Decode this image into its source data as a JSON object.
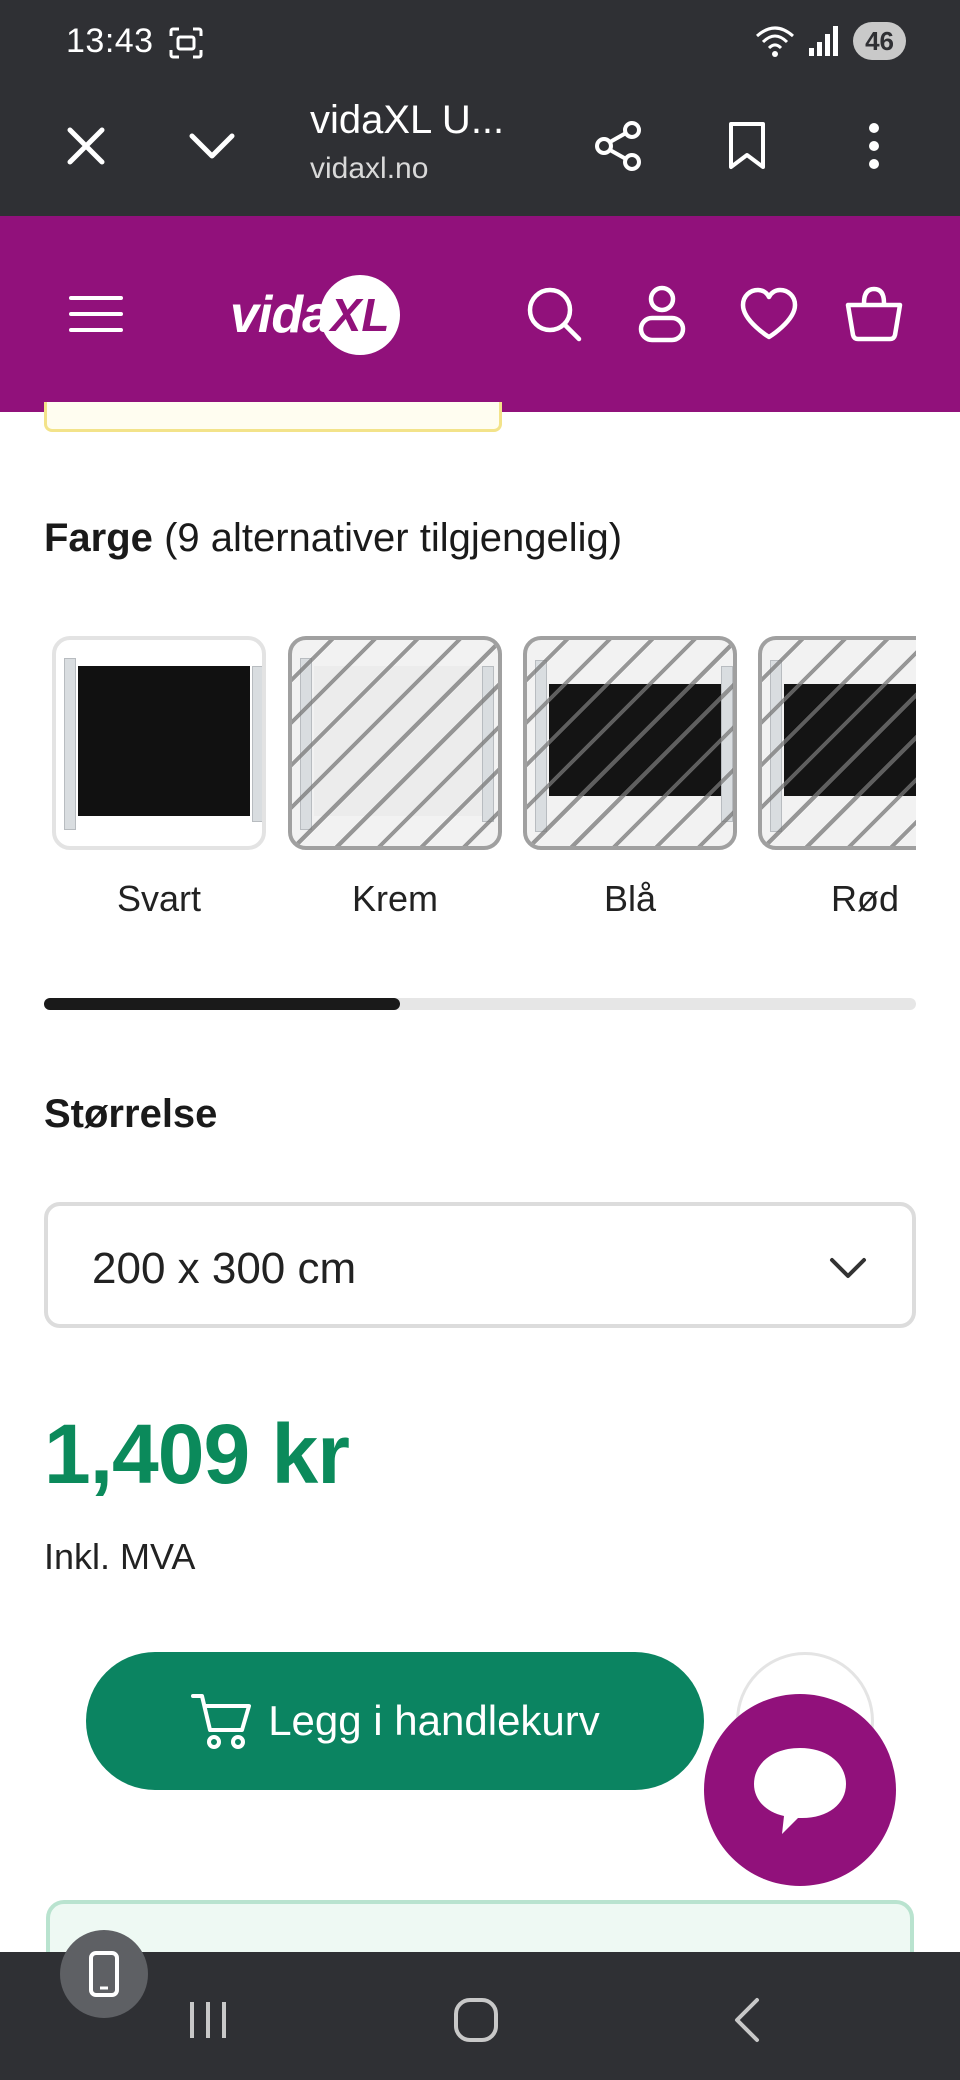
{
  "status_bar": {
    "time": "13:43",
    "battery": "46"
  },
  "browser": {
    "title": "vidaXL U...",
    "url": "vidaxl.no"
  },
  "site": {
    "logo_text": "vida",
    "logo_mark": "XL",
    "brand_color": "#91117b"
  },
  "product": {
    "color_heading": "Farge",
    "color_count": "(9 alternativer tilgjengelig)",
    "colors": [
      {
        "label": "Svart",
        "available": true,
        "selected": true
      },
      {
        "label": "Krem",
        "available": false
      },
      {
        "label": "Blå",
        "available": false
      },
      {
        "label": "Rød",
        "available": false
      }
    ],
    "size_heading": "Størrelse",
    "size_value": "200 x 300 cm",
    "price": "1,409 kr",
    "price_color": "#0b8a5b",
    "vat_note": "Inkl. MVA",
    "add_to_cart": "Legg i handlekurv"
  },
  "icons": {
    "browser": [
      "close-icon",
      "chevron-down-icon",
      "share-icon",
      "bookmark-icon",
      "more-vert-icon"
    ],
    "header": [
      "menu-icon",
      "search-icon",
      "user-icon",
      "heart-icon",
      "basket-icon"
    ],
    "nav": [
      "recents-icon",
      "home-icon",
      "back-icon"
    ]
  }
}
